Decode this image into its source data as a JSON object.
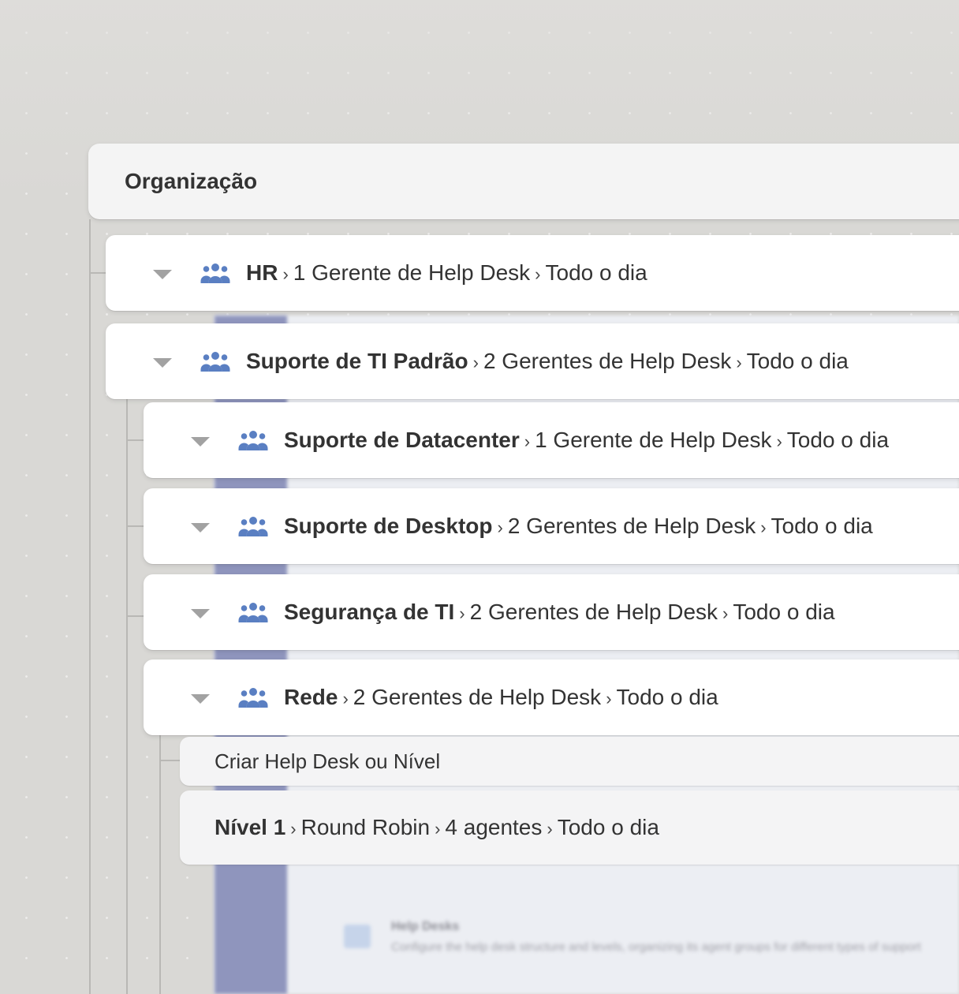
{
  "organization": {
    "title": "Organização"
  },
  "separator": "›",
  "rows": [
    {
      "name": "HR",
      "managers": "1 Gerente de Help Desk",
      "schedule": "Todo o dia"
    },
    {
      "name": "Suporte de TI Padrão",
      "managers": "2 Gerentes de Help Desk",
      "schedule": "Todo o dia"
    },
    {
      "name": "Suporte de Datacenter",
      "managers": "1 Gerente de Help Desk",
      "schedule": "Todo o dia"
    },
    {
      "name": "Suporte de Desktop",
      "managers": "2 Gerentes de Help Desk",
      "schedule": "Todo o dia"
    },
    {
      "name": "Segurança de TI",
      "managers": "2 Gerentes de Help Desk",
      "schedule": "Todo o dia"
    },
    {
      "name": "Rede",
      "managers": "2 Gerentes de Help Desk",
      "schedule": "Todo o dia"
    }
  ],
  "create_action": {
    "label": "Criar Help Desk ou Nível"
  },
  "level": {
    "name": "Nível 1",
    "routing": "Round Robin",
    "agents": "4 agentes",
    "schedule": "Todo o dia"
  },
  "background_screen": {
    "title": "Help Desks",
    "description": "Configure the help desk structure and levels, organizing its agent groups for different types of support"
  },
  "icons": {
    "expand": "caret-down-icon",
    "group": "people-group-icon"
  },
  "colors": {
    "icon_blue": "#5a7fc2",
    "caret_gray": "#a2a2a2",
    "sidebar_purple": "#8f95bd"
  }
}
